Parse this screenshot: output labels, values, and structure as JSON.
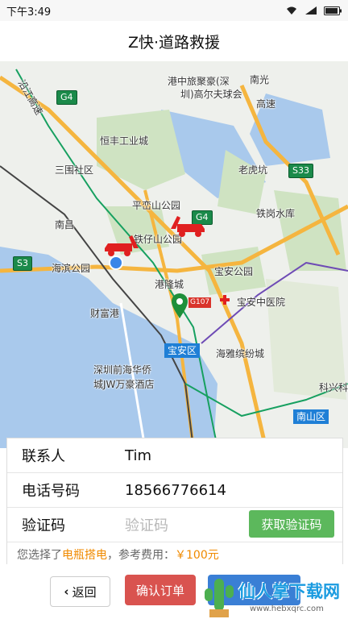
{
  "status_bar": {
    "time": "下午3:49",
    "icons": [
      "wifi-icon",
      "signal-icon",
      "battery-icon"
    ]
  },
  "header": {
    "title": "Z快·道路救援"
  },
  "map": {
    "labels": {
      "gangzhong": "港中旅聚豪(深",
      "gangzhong2": "圳)高尔夫球会",
      "hengfeng": "恒丰工业城",
      "sanwei": "三围社区",
      "laohukeng": "老虎坑",
      "pingluan": "平峦山公园",
      "tiegang": "铁岗水库",
      "nanchang": "南昌",
      "tiezai": "铁仔山公园",
      "haibin": "海滨公园",
      "baoan_park": "宝安公园",
      "ganglong": "港隆城",
      "baoan_hosp": "宝安中医院",
      "caifugang": "财富港",
      "haiya": "海雅缤纷城",
      "shenzhen_jw1": "深圳前海华侨",
      "shenzhen_jw2": "城JW万豪酒店",
      "kexing": "科兴科",
      "nanguang1": "南光",
      "nanguang2": "高速",
      "coastal": "沿江高速"
    },
    "road_badges": {
      "g4a": "G4",
      "g4b": "G4",
      "s33": "S33",
      "s3": "S3",
      "g107": "G107"
    },
    "districts": {
      "baoan": "宝安区",
      "nanshan": "南山区"
    }
  },
  "form": {
    "contact_label": "联系人",
    "contact_value": "Tim",
    "phone_label": "电话号码",
    "phone_value": "18566776614",
    "code_label": "验证码",
    "code_placeholder": "验证码",
    "get_code": "获取验证码",
    "note_prefix": "您选择了",
    "service": "电瓶搭电",
    "note_mid": "，参考费用：",
    "price": "￥100元"
  },
  "buttons": {
    "back": "返回",
    "confirm": "确认订单"
  },
  "watermark": {
    "text": "仙人掌下载网",
    "url": "www.hebxqrc.com"
  },
  "colors": {
    "accent_green": "#5cb85c",
    "danger_red": "#d9534f",
    "blue": "#3a7fd5",
    "orange": "#f08a00"
  }
}
